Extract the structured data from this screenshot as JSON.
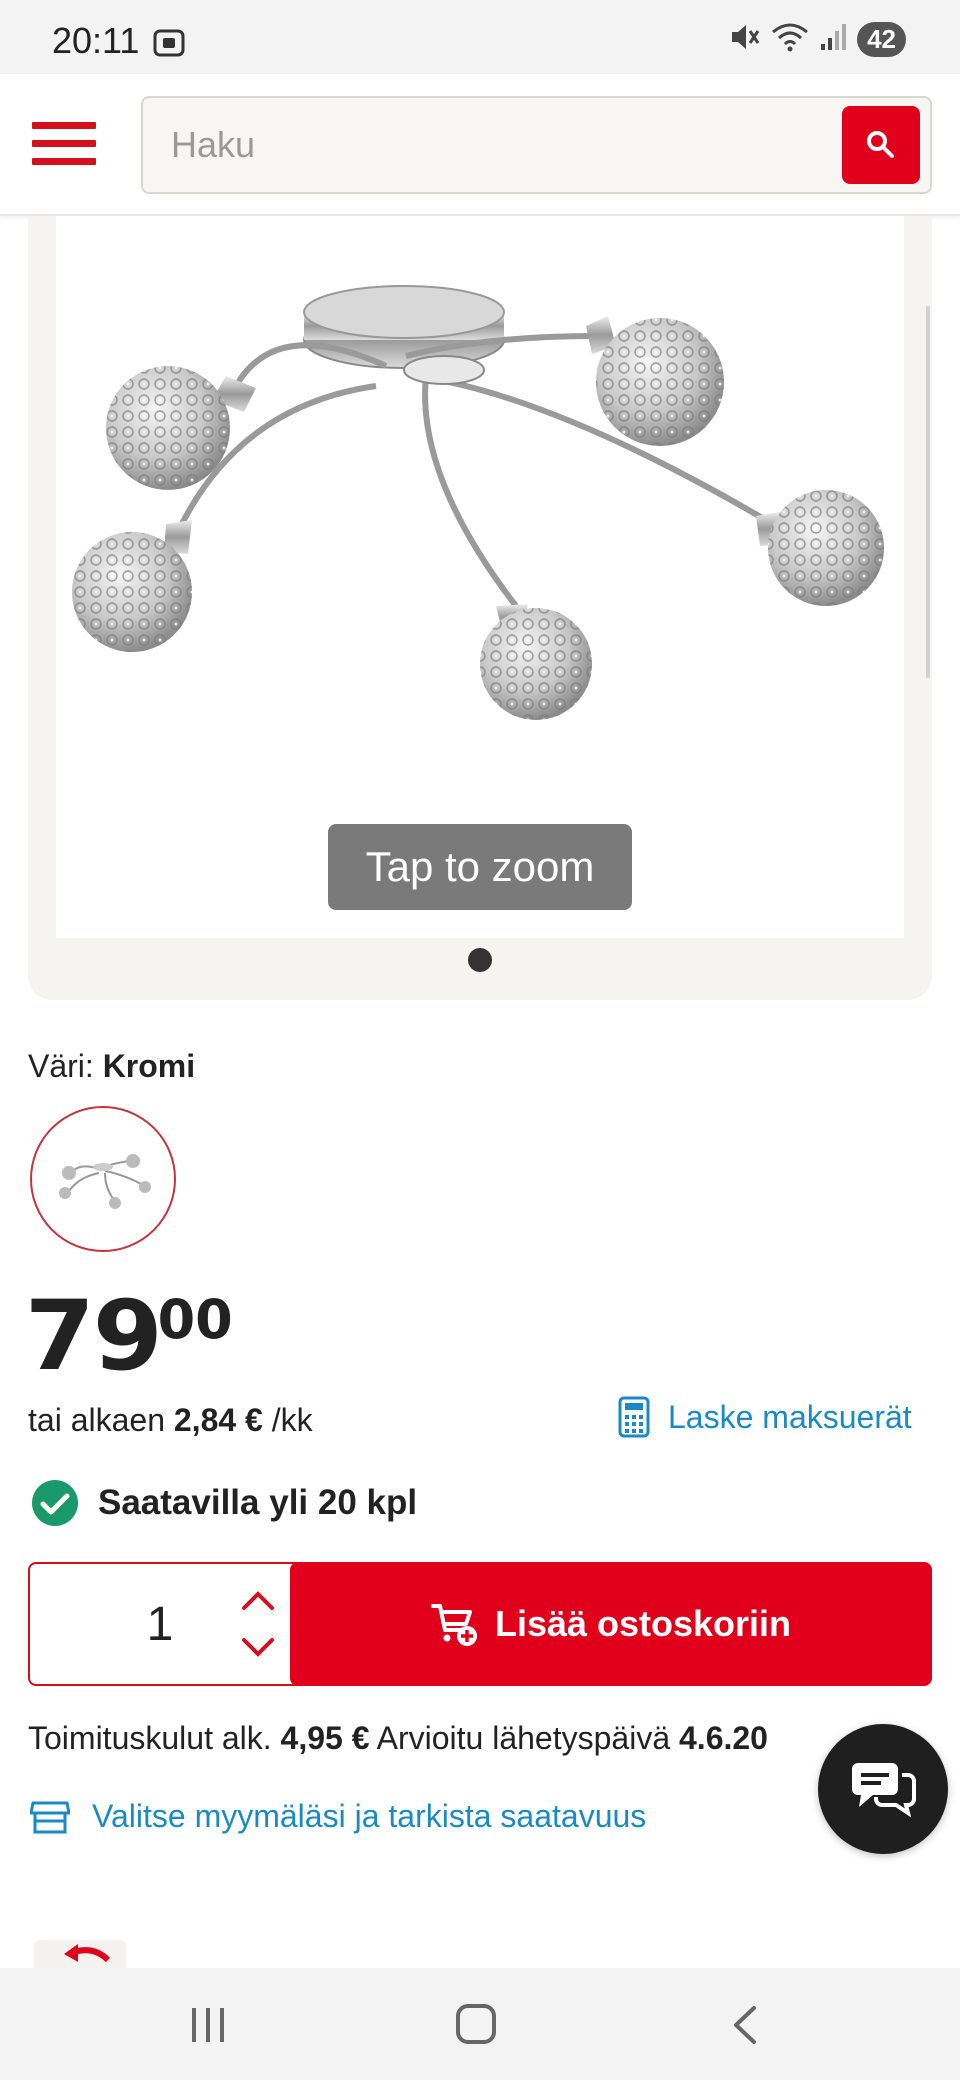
{
  "status_bar": {
    "time": "20:11",
    "battery": "42"
  },
  "header": {
    "search_placeholder": "Haku"
  },
  "gallery": {
    "zoom_hint": "Tap to zoom",
    "image_count": 1,
    "active_index": 0
  },
  "variant": {
    "label": "Väri:",
    "value": "Kromi"
  },
  "price": {
    "integer": "79",
    "decimals": "00"
  },
  "installment": {
    "prefix": "tai alkaen",
    "amount": "2,84 €",
    "suffix": "/kk",
    "calc_link": "Laske maksuerät"
  },
  "stock": {
    "text": "Saatavilla yli 20 kpl"
  },
  "cart": {
    "quantity": "1",
    "button_label": "Lisää ostoskoriin"
  },
  "shipping": {
    "cost_label": "Toimituskulut alk.",
    "cost_value": "4,95 €",
    "date_label": "Arvioitu lähetyspäivä",
    "date_value": "4.6.20"
  },
  "store": {
    "link_text": "Valitse myymäläsi ja tarkista saatavuus"
  },
  "colors": {
    "brand_red": "#e0001b",
    "link_blue": "#1a8ac6",
    "stock_green": "#1a9a6c"
  }
}
